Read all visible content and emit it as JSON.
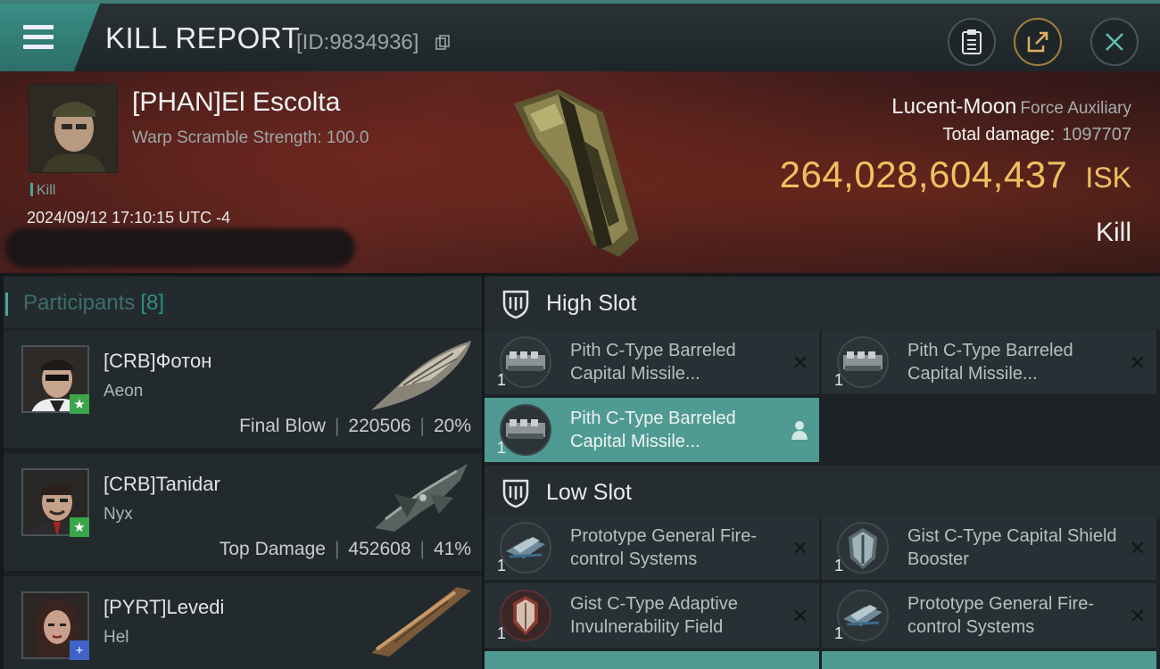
{
  "header": {
    "title": "KILL REPORT",
    "report_id": "[ID:9834936]"
  },
  "victim": {
    "name": "[PHAN]El Escolta",
    "warp_scramble": "Warp Scramble Strength: 100.0",
    "kill_tag": "Kill",
    "timestamp": "2024/09/12 17:10:15 UTC -4",
    "ship_name": "Lucent-Moon",
    "ship_class": "Force Auxiliary",
    "total_damage_label": "Total damage:",
    "total_damage_value": "1097707",
    "isk_value": "264,028,604,437",
    "isk_unit": "ISK",
    "result_label": "Kill"
  },
  "participants": {
    "title": "Participants",
    "count": "[8]",
    "items": [
      {
        "name": "[CRB]Фотон",
        "ship": "Aeon",
        "role": "Final Blow",
        "damage": "220506",
        "percent": "20%",
        "badge": "★",
        "badge_color": "#3aa54a"
      },
      {
        "name": "[CRB]Tanidar",
        "ship": "Nyx",
        "role": "Top Damage",
        "damage": "452608",
        "percent": "41%",
        "badge": "★",
        "badge_color": "#3aa54a"
      },
      {
        "name": "[PYRT]Levedi",
        "ship": "Hel",
        "role": "",
        "damage": "",
        "percent": "",
        "badge": "+",
        "badge_color": "#3d63c8"
      }
    ]
  },
  "fitting": {
    "high_slot": {
      "title": "High Slot",
      "modules": [
        {
          "name": "Pith C-Type Barreled Capital Missile...",
          "qty": "1",
          "icon": "missile-launcher-icon",
          "state": "close"
        },
        {
          "name": "Pith C-Type Barreled Capital Missile...",
          "qty": "1",
          "icon": "missile-launcher-icon",
          "state": "close"
        },
        {
          "name": "Pith C-Type Barreled Capital Missile...",
          "qty": "1",
          "icon": "missile-launcher-icon",
          "state": "person"
        }
      ]
    },
    "low_slot": {
      "title": "Low Slot",
      "modules": [
        {
          "name": "Prototype General Fire-control Systems",
          "qty": "1",
          "icon": "fire-control-icon",
          "state": "close"
        },
        {
          "name": "Gist C-Type Capital Shield Booster",
          "qty": "1",
          "icon": "shield-booster-icon",
          "state": "close"
        },
        {
          "name": "Gist C-Type Adaptive Invulnerability Field",
          "qty": "1",
          "icon": "invulnerability-field-icon",
          "state": "close"
        },
        {
          "name": "Prototype General Fire-control Systems",
          "qty": "1",
          "icon": "fire-control-icon",
          "state": "close"
        }
      ]
    }
  },
  "colors": {
    "accent": "#48a89d",
    "isk_gold": "#f0c060",
    "active_module": "#4f9b93"
  }
}
